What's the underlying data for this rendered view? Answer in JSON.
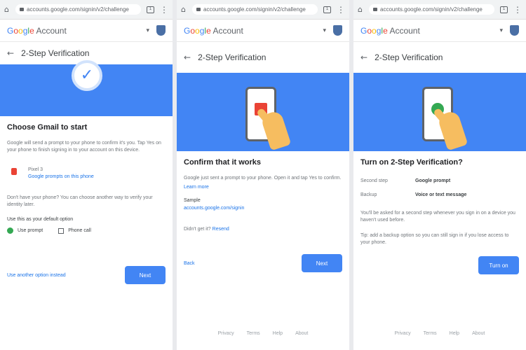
{
  "browser": {
    "url": "accounts.google.com/signin/v2/challenge"
  },
  "account": {
    "logo_letters": [
      "G",
      "o",
      "o",
      "g",
      "l",
      "e"
    ],
    "logo_suffix": " Account",
    "menu_glyph": "▾"
  },
  "panel1": {
    "step_title": "2-Step Verification",
    "heading": "Choose Gmail to start",
    "intro": "Google will send a prompt to your phone to confirm it's you. Tap Yes on your phone to finish signing in to your account on this device.",
    "device_name": "Pixel 3",
    "device_link": "Google prompts on this phone",
    "note": "Don't have your phone? You can choose another way to verify your identity later.",
    "option_label": "Use this as your default option",
    "radio_label": "Use prompt",
    "checkbox_label": "Phone call",
    "link": "Use another option instead",
    "button": "Next"
  },
  "panel2": {
    "step_title": "2-Step Verification",
    "heading": "Confirm that it works",
    "intro": "Google just sent a prompt to your phone. Open it and tap Yes to confirm.",
    "intro_link": "Learn more",
    "label": "Sample",
    "sample_link": "accounts.google.com/signin",
    "resend": "Didn't get it?",
    "resend_link": "Resend",
    "back": "Back",
    "button": "Next"
  },
  "panel3": {
    "step_title": "2-Step Verification",
    "heading": "Turn on 2-Step Verification?",
    "rows": [
      {
        "k": "Second step",
        "v": "Google prompt"
      },
      {
        "k": "Backup",
        "v": "Voice or text message"
      }
    ],
    "para1": "You'll be asked for a second step whenever you sign in on a device you haven't used before.",
    "para2": "Tip: add a backup option so you can still sign in if you lose access to your phone.",
    "button": "Turn on"
  },
  "footer": [
    "Privacy",
    "Terms",
    "Help",
    "About"
  ],
  "colors": {
    "brand_blue": "#4285f4",
    "red": "#ea4335",
    "green": "#34a853",
    "hand": "#f6bd60"
  }
}
